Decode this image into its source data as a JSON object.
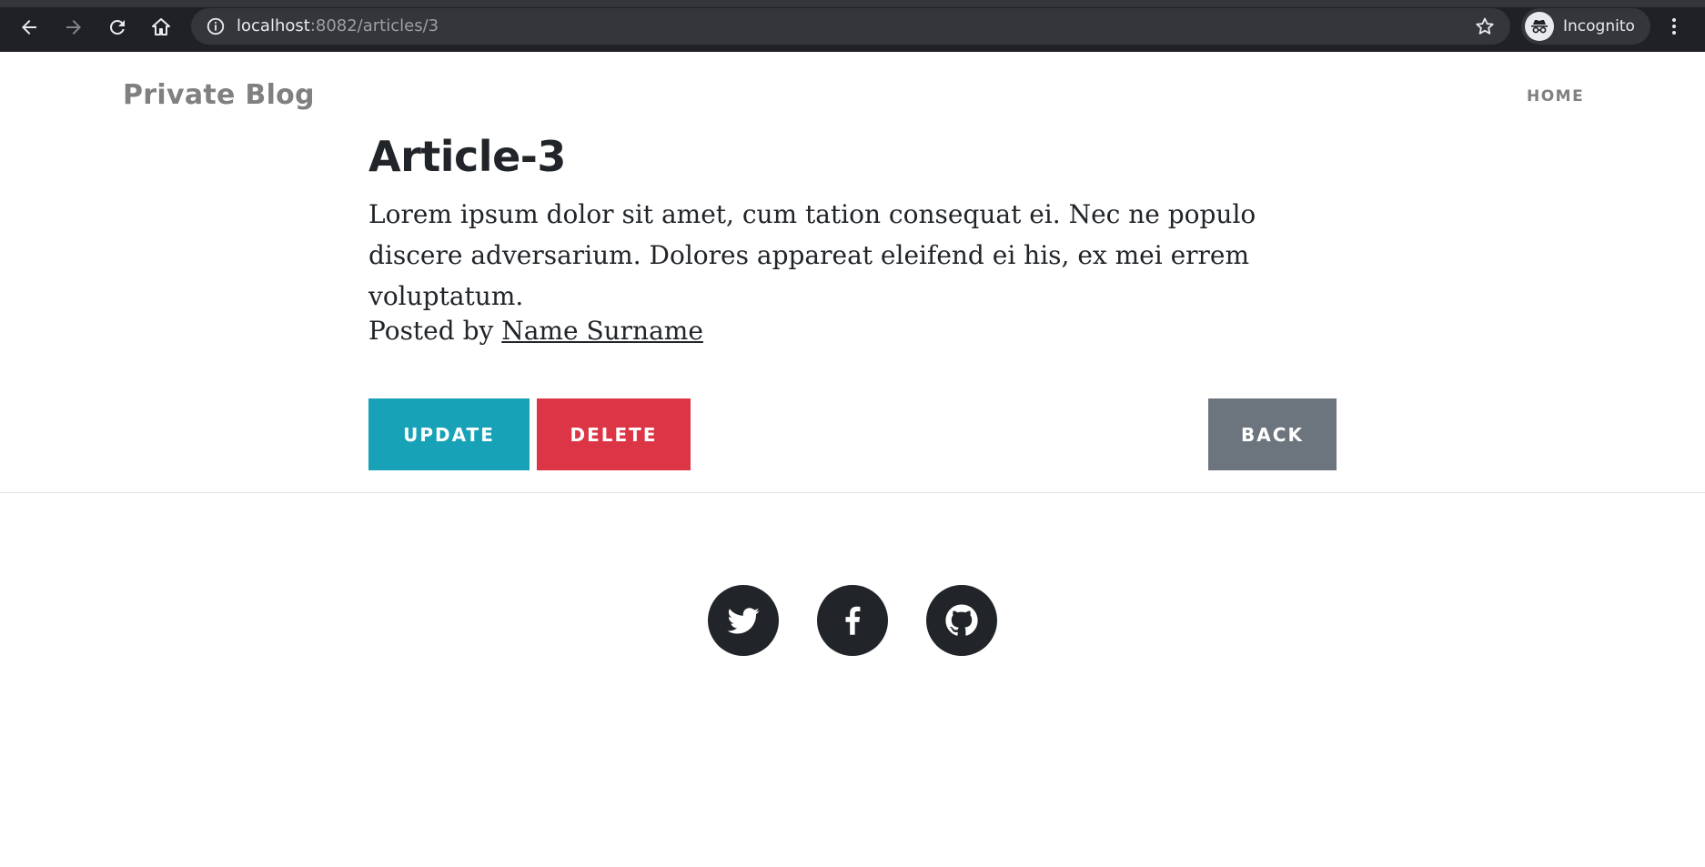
{
  "browser": {
    "url_host": "localhost",
    "url_path": ":8082/articles/3",
    "profile_label": "Incognito",
    "icons": {
      "back": "back-arrow-icon",
      "forward": "forward-arrow-icon",
      "reload": "reload-icon",
      "home": "home-icon",
      "info": "info-icon",
      "bookmark": "star-icon",
      "profile": "incognito-icon",
      "menu": "kebab-menu-icon"
    }
  },
  "site": {
    "brand": "Private Blog",
    "nav_home": "HOME"
  },
  "article": {
    "title": "Article-3",
    "body": "Lorem ipsum dolor sit amet, cum tation consequat ei. Nec ne populo discere adversarium. Dolores appareat eleifend ei his, ex mei errem voluptatum.",
    "posted_prefix": "Posted by ",
    "author": "Name Surname"
  },
  "actions": {
    "update": "UPDATE",
    "delete": "DELETE",
    "back": "BACK"
  },
  "footer": {
    "social": [
      "twitter-icon",
      "facebook-icon",
      "github-icon"
    ]
  },
  "colors": {
    "update": "#17a2b8",
    "delete": "#dc3545",
    "back": "#6c757d",
    "text": "#212529",
    "muted": "#808080",
    "chrome": "#202124"
  }
}
